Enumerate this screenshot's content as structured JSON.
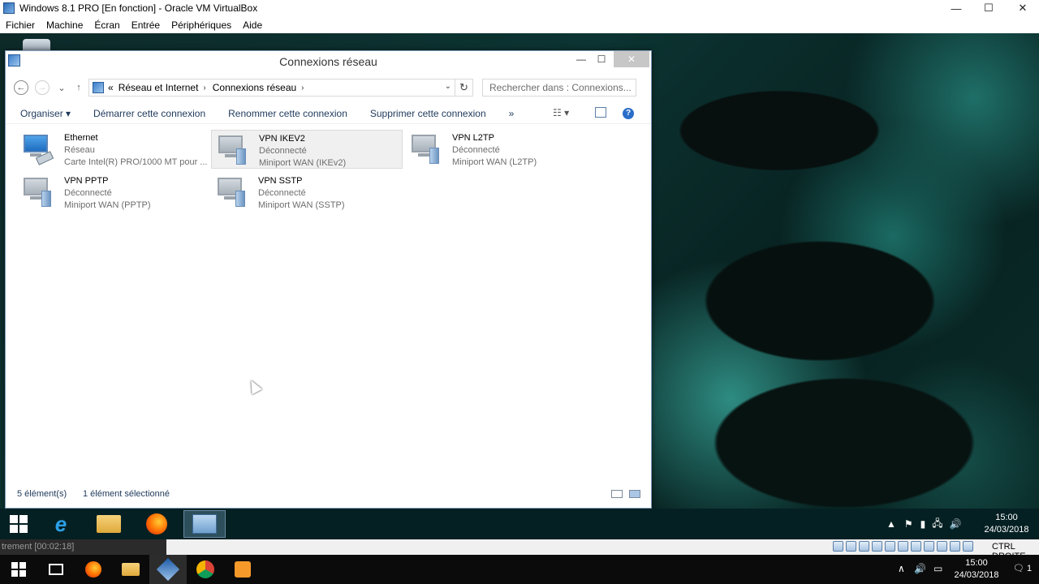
{
  "host": {
    "title": "Windows 8.1 PRO [En fonction] - Oracle VM VirtualBox",
    "menu": [
      "Fichier",
      "Machine",
      "Écran",
      "Entrée",
      "Périphériques",
      "Aide"
    ],
    "controls": {
      "minimize": "—",
      "maximize": "☐",
      "close": "✕"
    }
  },
  "window": {
    "title": "Connexions réseau",
    "controls": {
      "minimize": "—",
      "maximize": "☐",
      "close": "✕"
    },
    "address": {
      "prefix": "«",
      "crumbs": [
        "Réseau et Internet",
        "Connexions réseau"
      ],
      "separator": "›",
      "dropdown": "⌄",
      "refresh": "↻"
    },
    "search_placeholder": "Rechercher dans : Connexions...",
    "nav": {
      "back": "←",
      "forward": "→",
      "recent": "⌄",
      "up": "↑"
    },
    "commands": {
      "organize": "Organiser ▾",
      "start": "Démarrer cette connexion",
      "rename": "Renommer cette connexion",
      "delete": "Supprimer cette connexion",
      "more": "»",
      "help": "?"
    },
    "connections": [
      {
        "name": "Ethernet",
        "status": "Réseau",
        "device": "Carte Intel(R) PRO/1000 MT pour ..."
      },
      {
        "name": "VPN IKEV2",
        "status": "Déconnecté",
        "device": "Miniport WAN (IKEv2)"
      },
      {
        "name": "VPN L2TP",
        "status": "Déconnecté",
        "device": "Miniport WAN (L2TP)"
      },
      {
        "name": "VPN PPTP",
        "status": "Déconnecté",
        "device": "Miniport WAN (PPTP)"
      },
      {
        "name": "VPN SSTP",
        "status": "Déconnecté",
        "device": "Miniport WAN (SSTP)"
      }
    ],
    "status": {
      "count": "5 élément(s)",
      "selected": "1 élément sélectionné"
    }
  },
  "guest_taskbar": {
    "time": "15:00",
    "date": "24/03/2018"
  },
  "vbox_status": {
    "recording": "trement [00:02:18]",
    "host_key": "CTRL DROITE"
  },
  "host_taskbar": {
    "time": "15:00",
    "date": "24/03/2018",
    "notification_count": "1"
  },
  "colors": {
    "accent": "#2b6ec9",
    "link": "#1e395b",
    "selection": "#e5f3ff"
  }
}
